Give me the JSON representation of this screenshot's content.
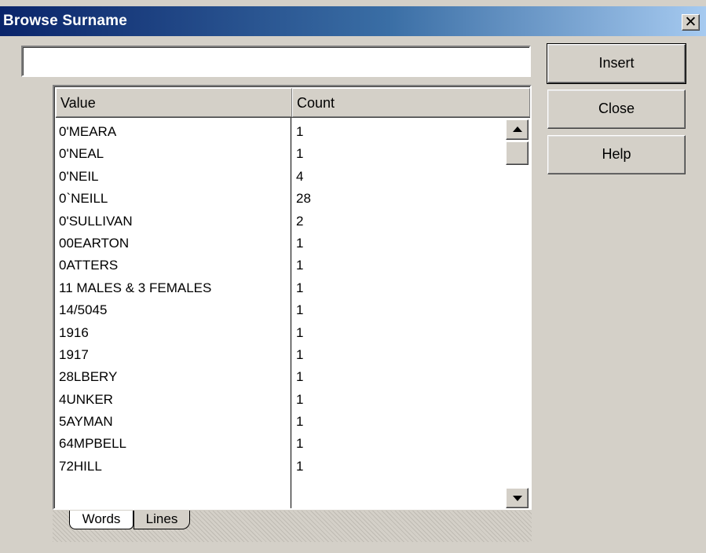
{
  "window": {
    "title": "Browse Surname",
    "close_glyph": "✕"
  },
  "search": {
    "value": ""
  },
  "buttons": {
    "insert": "Insert",
    "close": "Close",
    "help": "Help"
  },
  "list": {
    "columns": [
      "Value",
      "Count"
    ],
    "rows": [
      {
        "value": "0'MEARA",
        "count": "1"
      },
      {
        "value": "0'NEAL",
        "count": "1"
      },
      {
        "value": "0'NEIL",
        "count": "4"
      },
      {
        "value": "0`NEILL",
        "count": "28"
      },
      {
        "value": "0'SULLIVAN",
        "count": "2"
      },
      {
        "value": "00EARTON",
        "count": "1"
      },
      {
        "value": "0ATTERS",
        "count": "1"
      },
      {
        "value": "11 MALES & 3 FEMALES",
        "count": "1"
      },
      {
        "value": "14/5045",
        "count": "1"
      },
      {
        "value": "1916",
        "count": "1"
      },
      {
        "value": "1917",
        "count": "1"
      },
      {
        "value": "28LBERY",
        "count": "1"
      },
      {
        "value": "4UNKER",
        "count": "1"
      },
      {
        "value": "5AYMAN",
        "count": "1"
      },
      {
        "value": "64MPBELL",
        "count": "1"
      },
      {
        "value": "72HILL",
        "count": "1"
      }
    ]
  },
  "tabs": [
    "Words",
    "Lines"
  ],
  "icons": {
    "scroll_up": "scroll-up-arrow-icon",
    "scroll_down": "scroll-down-arrow-icon"
  }
}
